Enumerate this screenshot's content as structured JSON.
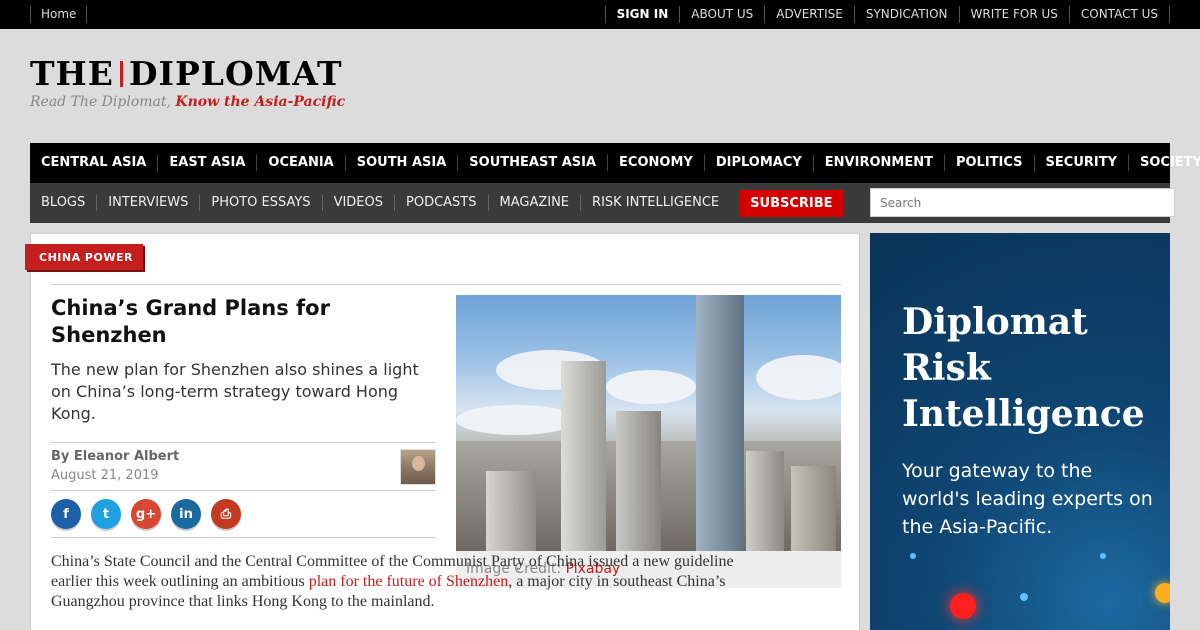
{
  "topbar": {
    "home": "Home",
    "links": [
      "SIGN IN",
      "ABOUT US",
      "ADVERTISE",
      "SYNDICATION",
      "WRITE FOR US",
      "CONTACT US"
    ]
  },
  "logo": {
    "part1": "THE",
    "part2": "DIPLOMAT",
    "tagline_plain": "Read The Diplomat, ",
    "tagline_bold": "Know the Asia-Pacific"
  },
  "main_nav": [
    "CENTRAL ASIA",
    "EAST ASIA",
    "OCEANIA",
    "SOUTH ASIA",
    "SOUTHEAST ASIA",
    "ECONOMY",
    "DIPLOMACY",
    "ENVIRONMENT",
    "POLITICS",
    "SECURITY",
    "SOCIETY"
  ],
  "sub_nav": [
    "BLOGS",
    "INTERVIEWS",
    "PHOTO ESSAYS",
    "VIDEOS",
    "PODCASTS",
    "MAGAZINE",
    "RISK INTELLIGENCE"
  ],
  "subscribe": "SUBSCRIBE",
  "search": {
    "placeholder": "Search"
  },
  "article": {
    "tag": "CHINA POWER",
    "headline": "China’s Grand Plans for Shenzhen",
    "dek": "The new plan for Shenzhen also shines a light on China’s long-term strategy toward Hong Kong.",
    "byline": "By Eleanor Albert",
    "date": "August 21, 2019",
    "share_icons": [
      "facebook-icon",
      "twitter-icon",
      "google-plus-icon",
      "linkedin-icon",
      "print-icon"
    ],
    "share_glyphs": [
      "f",
      "t",
      "g+",
      "in",
      "⎙"
    ],
    "share_colors": [
      "#1d5fa8",
      "#1fa0e0",
      "#d94732",
      "#1a6aa0",
      "#c43a20"
    ],
    "caption_label": "Image Credit: ",
    "caption_link": "Pixabay",
    "body_1": "China’s State Council and the Central Committee of the Communist Party of China issued a new guideline earlier this week outlining an ambitious ",
    "body_link": "plan for the future of Shenzhen",
    "body_2": ", a major city in southeast China’s Guangzhou province that links Hong Kong to the mainland."
  },
  "ad": {
    "title_lines": [
      "Diplomat",
      "Risk",
      "Intelligence"
    ],
    "subtitle": "Your gateway to the world's leading experts on the Asia-Pacific."
  },
  "colors": {
    "accent": "#c41e1e",
    "nav_bg": "#000000",
    "subnav_bg": "#3a3a3a",
    "ad_bg": "#0f4673"
  }
}
